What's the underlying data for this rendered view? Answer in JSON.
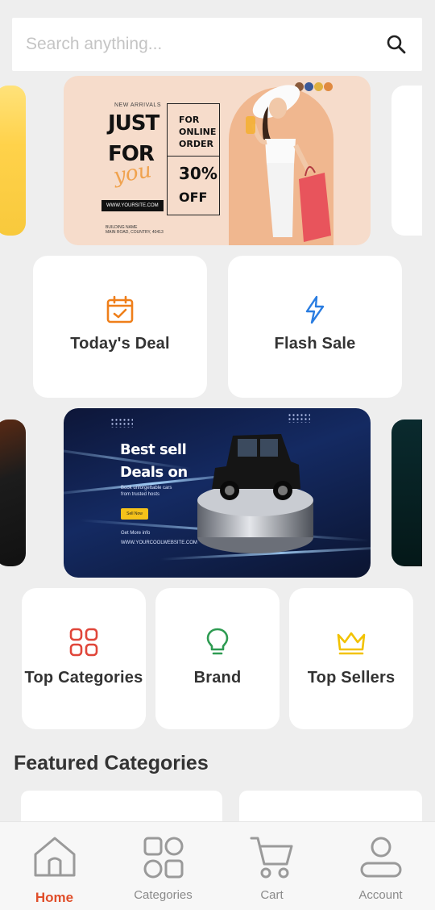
{
  "search": {
    "placeholder": "Search anything..."
  },
  "banner1": {
    "new_arrivals": "NEW ARRIVALS",
    "just": "JUST",
    "for": "FOR",
    "you": "you",
    "for_online_order": "FOR ONLINE ORDER",
    "discount": "30%",
    "off": "OFF",
    "website": "WWW.YOURSITE.COM",
    "address_line1": "BUILDING NAME",
    "address_line2": "MAIN ROAD, COUNTRY, 40413"
  },
  "quick_tiles": [
    {
      "label": "Today's Deal",
      "icon": "calendar-check-icon"
    },
    {
      "label": "Flash Sale",
      "icon": "lightning-icon"
    }
  ],
  "banner2": {
    "headline1": "Best sell",
    "headline2": "Deals on",
    "subtext1": "Book unforgettable cars",
    "subtext2": "from trusted hosts",
    "button": "Sell Now",
    "info_label": "Get More info",
    "website": "WWW.YOURCOOLWEBSITE.COM"
  },
  "category_tiles": [
    {
      "label": "Top Categories",
      "icon": "grid-icon"
    },
    {
      "label": "Brand",
      "icon": "lightbulb-icon"
    },
    {
      "label": "Top Sellers",
      "icon": "crown-icon"
    }
  ],
  "featured_title": "Featured Categories",
  "nav": [
    {
      "label": "Home",
      "icon": "home-icon",
      "active": true
    },
    {
      "label": "Categories",
      "icon": "categories-icon",
      "active": false
    },
    {
      "label": "Cart",
      "icon": "cart-icon",
      "active": false
    },
    {
      "label": "Account",
      "icon": "account-icon",
      "active": false
    }
  ],
  "colors": {
    "accent": "#e04e2a",
    "icon_orange": "#ef7f1a",
    "icon_blue": "#2a7de1",
    "icon_red": "#e0463a",
    "icon_green": "#2e9b52",
    "icon_yellow": "#f2c200"
  }
}
